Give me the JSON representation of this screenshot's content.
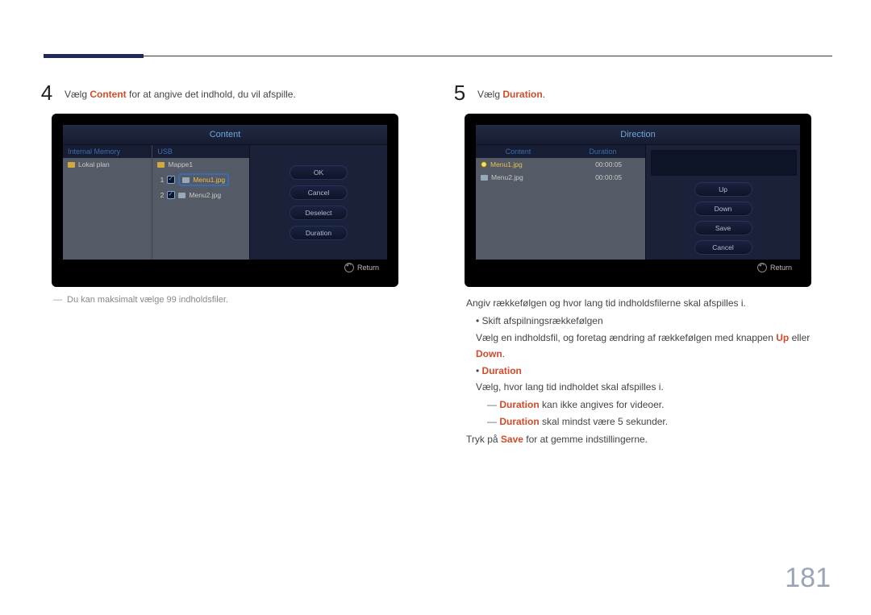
{
  "step4": {
    "num": "4",
    "text_pre": "Vælg ",
    "text_em": "Content",
    "text_post": " for at angive det indhold, du vil afspille.",
    "note": "Du kan maksimalt vælge 99 indholdsfiler."
  },
  "step5": {
    "num": "5",
    "text_pre": "Vælg ",
    "text_em": "Duration",
    "text_post": "."
  },
  "panel4": {
    "title": "Content",
    "col1_head": "Internal Memory",
    "col2_head": "USB",
    "folder1": "Lokal plan",
    "folder2": "Mappe1",
    "file1": "Menu1.jpg",
    "file2": "Menu2.jpg",
    "n1": "1",
    "n2": "2",
    "btn_ok": "OK",
    "btn_cancel": "Cancel",
    "btn_deselect": "Deselect",
    "btn_duration": "Duration",
    "return": "Return"
  },
  "panel5": {
    "title": "Direction",
    "head_content": "Content",
    "head_duration": "Duration",
    "file1": "Menu1.jpg",
    "file2": "Menu2.jpg",
    "dur1": "00:00:05",
    "dur2": "00:00:05",
    "btn_up": "Up",
    "btn_down": "Down",
    "btn_save": "Save",
    "btn_cancel": "Cancel",
    "return": "Return"
  },
  "desc5": {
    "line1": "Angiv rækkefølgen og hvor lang tid indholdsfilerne skal afspilles i.",
    "order_head": "Skift afspilningsrækkefølgen",
    "order_body_pre": "Vælg en indholdsfil, og foretag ændring af rækkefølgen med knappen ",
    "up": "Up",
    "mid_or": " eller ",
    "down": "Down",
    "order_body_post": ".",
    "duration_head": "Duration",
    "duration_body": "Vælg, hvor lang tid indholdet skal afspilles i.",
    "note1_em": "Duration",
    "note1_rest": " kan ikke angives for videoer.",
    "note2_em": "Duration",
    "note2_rest": " skal mindst være 5 sekunder.",
    "save_pre": "Tryk på ",
    "save_em": "Save",
    "save_post": " for at gemme indstillingerne."
  },
  "page_number": "181"
}
